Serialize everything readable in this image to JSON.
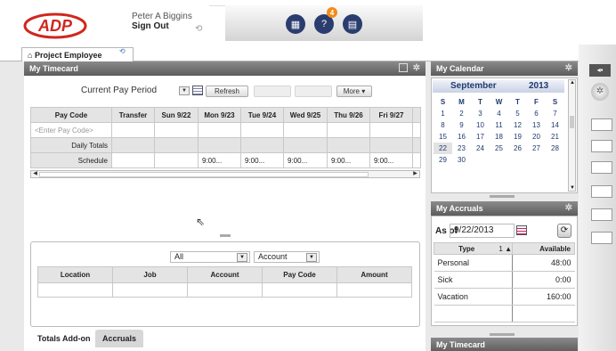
{
  "header": {
    "user_name": "Peter A Biggins",
    "sign_out": "Sign Out",
    "logo_text": "ADP",
    "badge_count": "4"
  },
  "tabs": {
    "active_tab": "Project Employee"
  },
  "timecard": {
    "title": "My Timecard",
    "period": "Current Pay Period",
    "refresh_label": "Refresh",
    "more_label": "More",
    "columns": [
      "Pay Code",
      "Transfer",
      "Sun 9/22",
      "Mon 9/23",
      "Tue 9/24",
      "Wed 9/25",
      "Thu 9/26",
      "Fri 9/27"
    ],
    "enter_pay_code": "<Enter Pay Code>",
    "daily_totals": "Daily Totals",
    "schedule_label": "Schedule",
    "schedule": [
      "",
      "",
      "9:00...",
      "9:00...",
      "9:00...",
      "9:00...",
      "9:00..."
    ]
  },
  "totals": {
    "filter_all": "All",
    "filter_account": "Account",
    "columns": [
      "Location",
      "Job",
      "Account",
      "Pay Code",
      "Amount"
    ],
    "tab_totals": "Totals Add-on",
    "tab_accruals": "Accruals"
  },
  "calendar": {
    "title": "My Calendar",
    "month": "September",
    "year": "2013",
    "weekdays": [
      "S",
      "M",
      "T",
      "W",
      "T",
      "F",
      "S"
    ],
    "weeks": [
      [
        "1",
        "2",
        "3",
        "4",
        "5",
        "6",
        "7"
      ],
      [
        "8",
        "9",
        "10",
        "11",
        "12",
        "13",
        "14"
      ],
      [
        "15",
        "16",
        "17",
        "18",
        "19",
        "20",
        "21"
      ],
      [
        "22",
        "23",
        "24",
        "25",
        "26",
        "27",
        "28"
      ],
      [
        "29",
        "30",
        "",
        "",
        "",
        "",
        ""
      ]
    ],
    "selected_day": "22"
  },
  "accruals": {
    "title": "My Accruals",
    "as_of_label": "As of",
    "as_of_date": "9/22/2013",
    "col_type": "Type",
    "col_sort": "1 ▲",
    "col_available": "Available",
    "rows": [
      {
        "type": "Personal",
        "available": "48:00"
      },
      {
        "type": "Sick",
        "available": "0:00"
      },
      {
        "type": "Vacation",
        "available": "160:00"
      }
    ]
  },
  "bottom_panel": {
    "title": "My Timecard"
  }
}
